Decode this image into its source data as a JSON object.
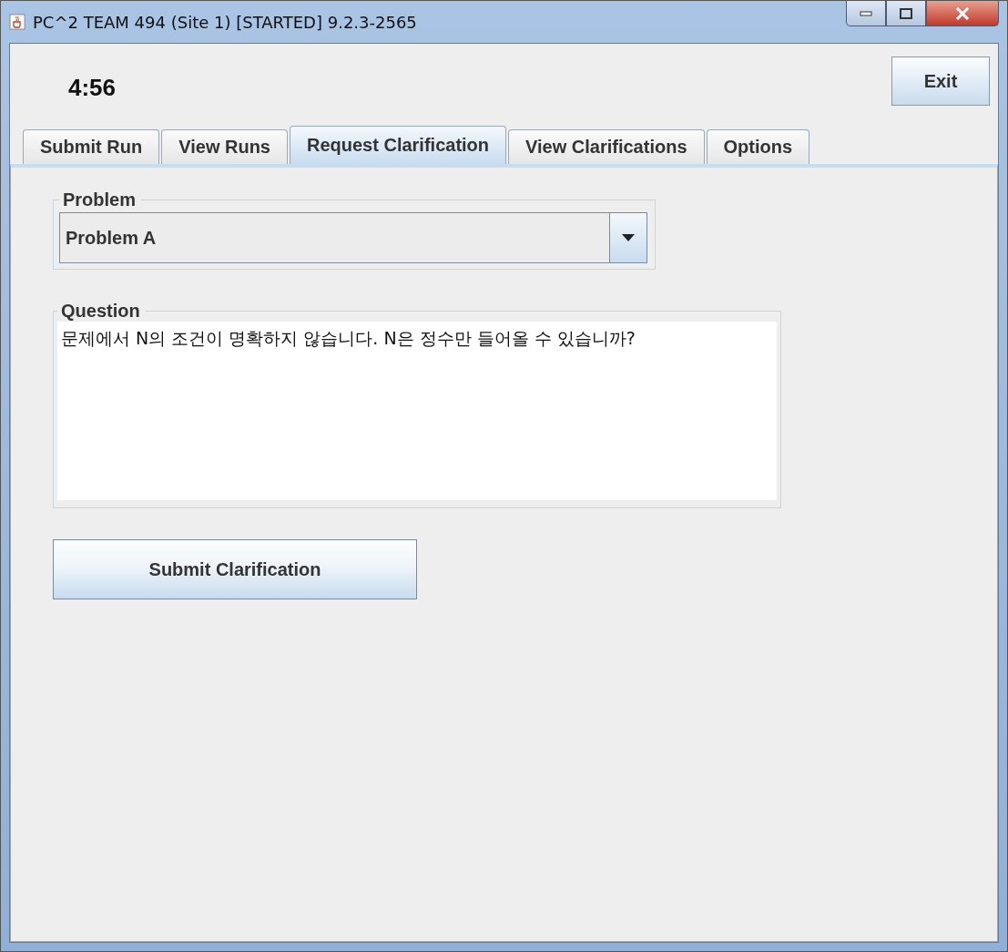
{
  "window": {
    "title": "PC^2 TEAM 494 (Site 1) [STARTED] 9.2.3-2565"
  },
  "clock": "4:56",
  "exit_button": "Exit",
  "tabs": [
    {
      "label": "Submit Run",
      "selected": false
    },
    {
      "label": "View Runs",
      "selected": false
    },
    {
      "label": "Request Clarification",
      "selected": true
    },
    {
      "label": "View Clarifications",
      "selected": false
    },
    {
      "label": "Options",
      "selected": false
    }
  ],
  "problem": {
    "legend": "Problem",
    "value": "Problem A"
  },
  "question": {
    "legend": "Question",
    "value": "문제에서 N의 조건이 명확하지 않습니다. N은 정수만 들어올 수 있습니까?"
  },
  "submit_button": "Submit Clarification"
}
